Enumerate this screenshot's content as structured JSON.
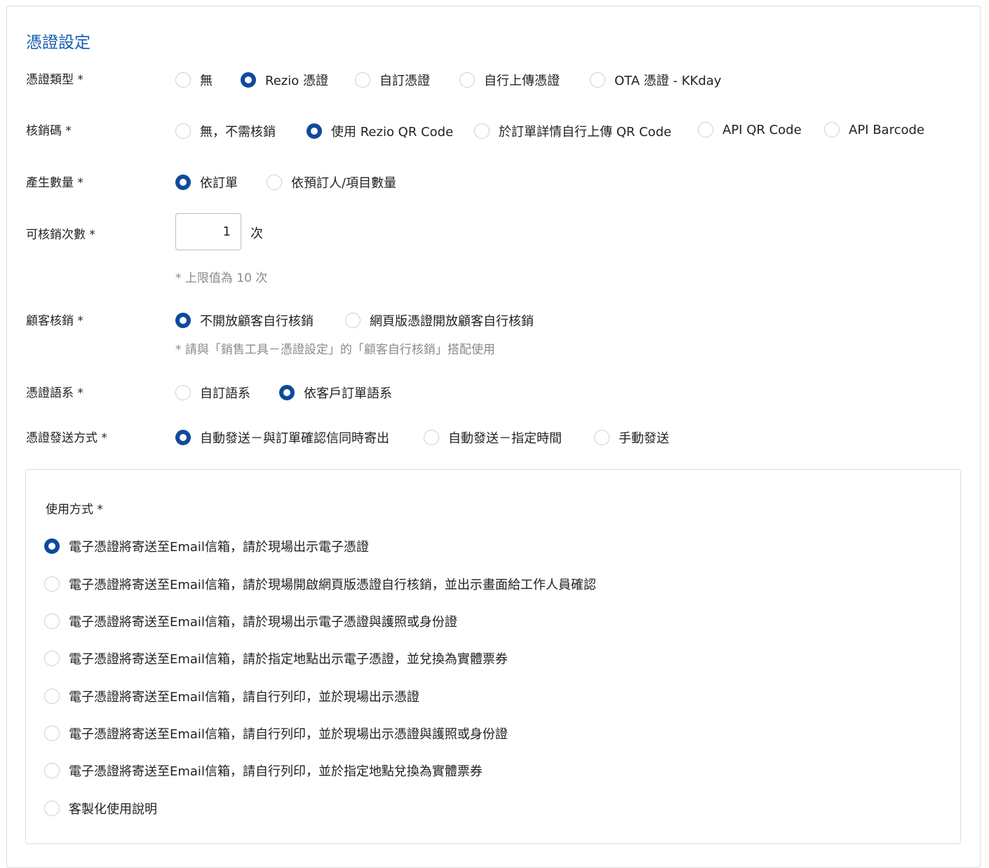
{
  "section_title": "憑證設定",
  "fields": {
    "voucher_type": {
      "label": "憑證類型 *",
      "options": [
        "無",
        "Rezio 憑證",
        "自訂憑證",
        "自行上傳憑證",
        "OTA 憑證 - KKday"
      ],
      "selected": 1
    },
    "redeem_code": {
      "label": "核銷碼 *",
      "options": [
        "無，不需核銷",
        "使用 Rezio QR Code",
        "於訂單詳情自行上傳 QR Code",
        "API QR Code",
        "API Barcode"
      ],
      "selected": 1
    },
    "quantity": {
      "label": "產生數量 *",
      "options": [
        "依訂單",
        "依預訂人/項目數量"
      ],
      "selected": 0
    },
    "redeem_times": {
      "label": "可核銷次數 *",
      "value": "1",
      "unit": "次",
      "hint": "* 上限值為 10 次"
    },
    "customer_redeem": {
      "label": "顧客核銷 *",
      "options": [
        "不開放顧客自行核銷",
        "網頁版憑證開放顧客自行核銷"
      ],
      "selected": 0,
      "hint": "* 請與「銷售工具－憑證設定」的「顧客自行核銷」搭配使用"
    },
    "voucher_language": {
      "label": "憑證語系 *",
      "options": [
        "自訂語系",
        "依客戶訂單語系"
      ],
      "selected": 1
    },
    "send_method": {
      "label": "憑證發送方式 *",
      "options": [
        "自動發送－與訂單確認信同時寄出",
        "自動發送－指定時間",
        "手動發送"
      ],
      "selected": 0
    }
  },
  "usage": {
    "label": "使用方式 *",
    "options": [
      "電子憑證將寄送至Email信箱，請於現場出示電子憑證",
      "電子憑證將寄送至Email信箱，請於現場開啟網頁版憑證自行核銷，並出示畫面給工作人員確認",
      "電子憑證將寄送至Email信箱，請於現場出示電子憑證與護照或身份證",
      "電子憑證將寄送至Email信箱，請於指定地點出示電子憑證，並兌換為實體票券",
      "電子憑證將寄送至Email信箱，請自行列印，並於現場出示憑證",
      "電子憑證將寄送至Email信箱，請自行列印，並於現場出示憑證與護照或身份證",
      "電子憑證將寄送至Email信箱，請自行列印，並於指定地點兌換為實體票券",
      "客製化使用說明"
    ],
    "selected": 0
  },
  "colors": {
    "accent": "#0f4a9c",
    "title": "#1a5cb0",
    "hint": "#8a8a8a",
    "border": "#dcdcdc"
  }
}
